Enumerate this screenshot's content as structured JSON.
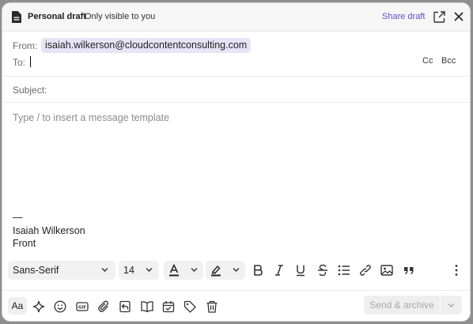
{
  "header": {
    "title": "Personal draft",
    "subtitle": "Only visible to you",
    "share_label": "Share draft"
  },
  "compose": {
    "from_label": "From:",
    "from_value": "isaiah.wilkerson@cloudcontentconsulting.com",
    "to_label": "To:",
    "to_value": "",
    "cc_label": "Cc",
    "bcc_label": "Bcc",
    "subject_label": "Subject:",
    "subject_value": "",
    "body_placeholder": "Type / to insert a message template",
    "signature_dash": "—",
    "signature_name": "Isaiah Wilkerson",
    "signature_company": "Front"
  },
  "format": {
    "font_family": "Sans-Serif",
    "font_size": "14"
  },
  "actions": {
    "aa_label": "Aa",
    "send_label": "Send & archive"
  },
  "colors": {
    "accent": "#5b4fd1",
    "chip_bg": "#e7e4f6"
  }
}
